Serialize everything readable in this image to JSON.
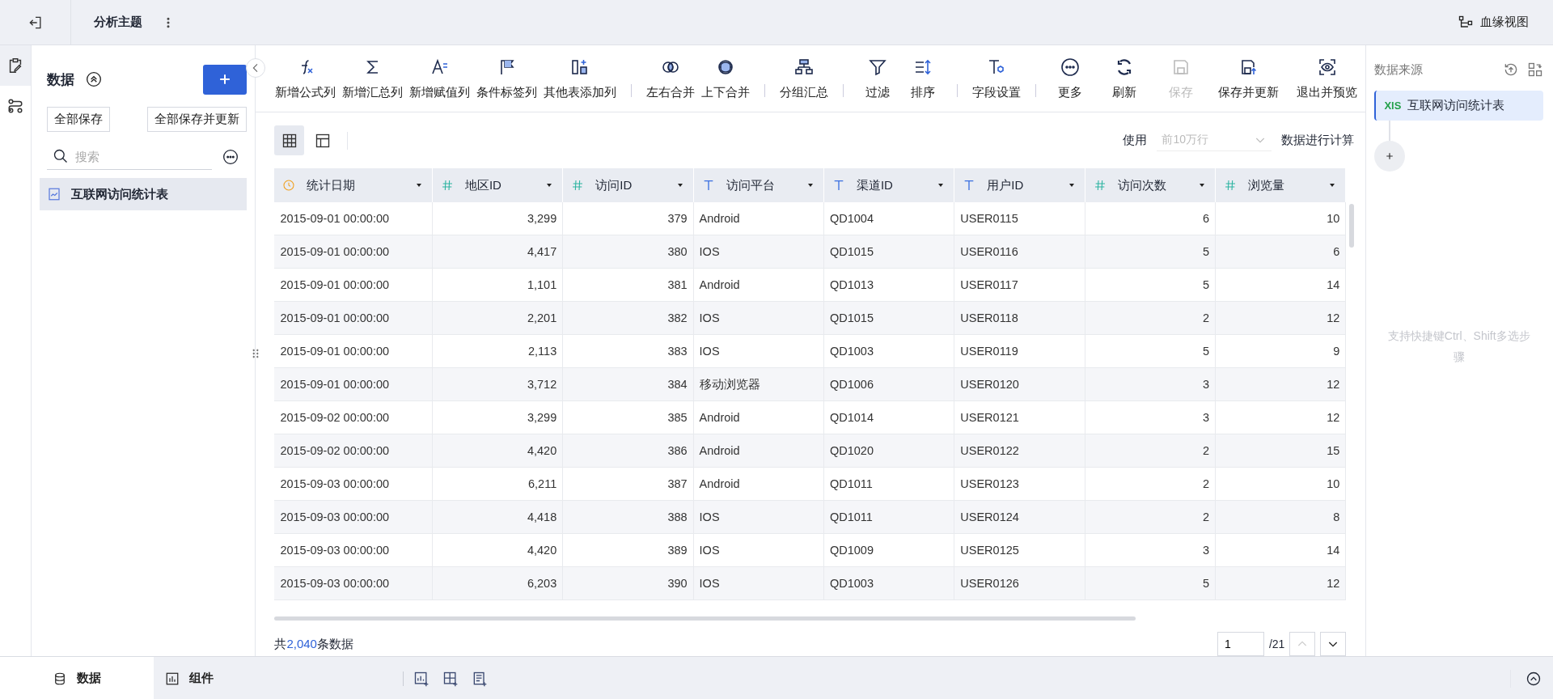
{
  "topbar": {
    "title": "分析主题",
    "lineage_label": "血缘视图"
  },
  "rail": [
    {
      "selected": true
    },
    {
      "selected": false
    }
  ],
  "data_panel": {
    "title": "数据",
    "buttons": [
      "全部保存",
      "全部保存并更新"
    ],
    "search": {
      "placeholder": "搜索"
    },
    "items": [
      {
        "label": "互联网访问统计表",
        "selected": true
      }
    ]
  },
  "toolbar": {
    "groups": [
      [
        {
          "label": "新增公式列"
        },
        {
          "label": "新增汇总列"
        },
        {
          "label": "新增赋值列"
        },
        {
          "label": "条件标签列"
        },
        {
          "label": "其他表添加列"
        }
      ],
      [
        {
          "label": "左右合并"
        },
        {
          "label": "上下合并"
        }
      ],
      [
        {
          "label": "分组汇总"
        }
      ],
      [
        {
          "label": "过滤"
        },
        {
          "label": "排序"
        }
      ],
      [
        {
          "label": "字段设置"
        }
      ],
      [
        {
          "label": "更多"
        }
      ]
    ],
    "actions": [
      {
        "label": "刷新",
        "disabled": false
      },
      {
        "label": "保存",
        "disabled": true
      },
      {
        "label": "保存并更新",
        "disabled": false
      },
      {
        "label": "退出并预览",
        "disabled": false
      }
    ]
  },
  "view_toggles": [
    {
      "selected": true
    },
    {
      "selected": false
    }
  ],
  "compute": {
    "prefix": "使用",
    "select_placeholder": "前10万行",
    "suffix": "数据进行计算"
  },
  "table": {
    "columns": [
      {
        "label": "统计日期",
        "kind": "date"
      },
      {
        "label": "地区ID",
        "kind": "number"
      },
      {
        "label": "访问ID",
        "kind": "number"
      },
      {
        "label": "访问平台",
        "kind": "text"
      },
      {
        "label": "渠道ID",
        "kind": "text"
      },
      {
        "label": "用户ID",
        "kind": "text"
      },
      {
        "label": "访问次数",
        "kind": "number"
      },
      {
        "label": "浏览量",
        "kind": "number"
      }
    ],
    "rows": [
      [
        "2015-09-01 00:00:00",
        "3,299",
        "379",
        "Android",
        "QD1004",
        "USER0115",
        "6",
        "10"
      ],
      [
        "2015-09-01 00:00:00",
        "4,417",
        "380",
        "IOS",
        "QD1015",
        "USER0116",
        "5",
        "6"
      ],
      [
        "2015-09-01 00:00:00",
        "1,101",
        "381",
        "Android",
        "QD1013",
        "USER0117",
        "5",
        "14"
      ],
      [
        "2015-09-01 00:00:00",
        "2,201",
        "382",
        "IOS",
        "QD1015",
        "USER0118",
        "2",
        "12"
      ],
      [
        "2015-09-01 00:00:00",
        "2,113",
        "383",
        "IOS",
        "QD1003",
        "USER0119",
        "5",
        "9"
      ],
      [
        "2015-09-01 00:00:00",
        "3,712",
        "384",
        "移动浏览器",
        "QD1006",
        "USER0120",
        "3",
        "12"
      ],
      [
        "2015-09-02 00:00:00",
        "3,299",
        "385",
        "Android",
        "QD1014",
        "USER0121",
        "3",
        "12"
      ],
      [
        "2015-09-02 00:00:00",
        "4,420",
        "386",
        "Android",
        "QD1020",
        "USER0122",
        "2",
        "15"
      ],
      [
        "2015-09-03 00:00:00",
        "6,211",
        "387",
        "Android",
        "QD1011",
        "USER0123",
        "2",
        "10"
      ],
      [
        "2015-09-03 00:00:00",
        "4,418",
        "388",
        "IOS",
        "QD1011",
        "USER0124",
        "2",
        "8"
      ],
      [
        "2015-09-03 00:00:00",
        "4,420",
        "389",
        "IOS",
        "QD1009",
        "USER0125",
        "3",
        "14"
      ],
      [
        "2015-09-03 00:00:00",
        "6,203",
        "390",
        "IOS",
        "QD1003",
        "USER0126",
        "5",
        "12"
      ]
    ]
  },
  "footer": {
    "total_prefix": "共",
    "total": "2,040",
    "total_suffix": "条数据"
  },
  "pagination": {
    "page": "1",
    "pages": "/21"
  },
  "source_panel": {
    "title": "数据来源",
    "source": {
      "badge": "XlS",
      "label": "互联网访问统计表",
      "selected": true
    },
    "hint": "支持快捷键Ctrl、Shift多选步骤"
  },
  "bottom_tabs": [
    {
      "label": "数据",
      "selected": true
    },
    {
      "label": "组件",
      "selected": false
    }
  ]
}
